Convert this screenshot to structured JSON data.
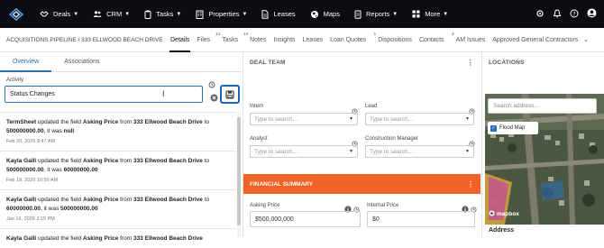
{
  "nav": {
    "items": [
      {
        "label": "Deals",
        "icon": "handshake-icon",
        "caret": true
      },
      {
        "label": "CRM",
        "icon": "people-icon",
        "caret": true
      },
      {
        "label": "Tasks",
        "icon": "clipboard-icon",
        "caret": true
      },
      {
        "label": "Properties",
        "icon": "building-icon",
        "caret": true
      },
      {
        "label": "Leases",
        "icon": "document-icon",
        "caret": false
      },
      {
        "label": "Maps",
        "icon": "globe-icon",
        "caret": false
      },
      {
        "label": "Reports",
        "icon": "report-icon",
        "caret": true
      },
      {
        "label": "More",
        "icon": "grid-icon",
        "caret": true
      }
    ],
    "caret_glyph": "▼"
  },
  "breadcrumb": "ACQUISITIONS PIPELINE / 333 ELLWOOD BEACH DRIVE",
  "tabs": [
    {
      "label": "Details",
      "count": ""
    },
    {
      "label": "Files",
      "count": "14"
    },
    {
      "label": "Tasks",
      "count": "14"
    },
    {
      "label": "Notes",
      "count": ""
    },
    {
      "label": "Insights",
      "count": ""
    },
    {
      "label": "Leases",
      "count": ""
    },
    {
      "label": "Loan Quotes",
      "count": "1"
    },
    {
      "label": "Dispositions",
      "count": ""
    },
    {
      "label": "Contacts",
      "count": "3"
    },
    {
      "label": "AM Issues",
      "count": ""
    },
    {
      "label": "Approved General Contractors",
      "count": ""
    }
  ],
  "left": {
    "subtabs": [
      "Overview",
      "Associations"
    ],
    "activity_label": "Activity",
    "activity_value": "Status Changes",
    "entries": [
      {
        "actor": "TermSheet",
        "t1": " updated the field ",
        "field": "Asking Price",
        "t2": " from ",
        "from": "333 Ellwood Beach Drive",
        "t3": " to ",
        "to": "500000000.00",
        "t4": ", it was ",
        "was": "null",
        "ts": "Feb 20, 2026 8:47 AM"
      },
      {
        "actor": "Kayla Galli",
        "t1": " updated the field ",
        "field": "Asking Price",
        "t2": " from ",
        "from": "333 Ellwood Beach Drive",
        "t3": " to ",
        "to": "500000000.00",
        "t4": ", it was ",
        "was": "60000000.00",
        "ts": "Feb 19, 2026 10:59 AM"
      },
      {
        "actor": "Kayla Galli",
        "t1": " updated the field ",
        "field": "Asking Price",
        "t2": " from ",
        "from": "333 Ellwood Beach Drive",
        "t3": " to ",
        "to": "60000000.00",
        "t4": ", it was ",
        "was": "500000000.00",
        "ts": "Jan 16, 2026 2:15 PM"
      },
      {
        "actor": "Kayla Galli",
        "t1": " updated the field ",
        "field": "Asking Price",
        "t2": " from ",
        "from": "333 Ellwood Beach Drive",
        "t3": "",
        "to": "",
        "t4": "",
        "was": "",
        "ts": ""
      }
    ]
  },
  "deal_team": {
    "title": "DEAL TEAM",
    "fields": [
      {
        "label": "Intern",
        "placeholder": "Type to search..."
      },
      {
        "label": "Lead",
        "placeholder": "Type to search..."
      },
      {
        "label": "Analyst",
        "placeholder": "Type to search..."
      },
      {
        "label": "Construction Manager",
        "placeholder": "Type to search..."
      }
    ]
  },
  "financial": {
    "title": "FINANCIAL SUMMARY",
    "asking_label": "Asking Price",
    "asking_value": "$500,000,000",
    "internal_label": "Internal Price",
    "internal_value": "$0"
  },
  "locations": {
    "title": "LOCATIONS",
    "search_placeholder": "Search address...",
    "flood_label": "Flood Map",
    "mapbox_label": "mapbox",
    "address_label": "Address"
  },
  "colors": {
    "accent": "#1d63b3",
    "financial_header": "#f06223",
    "nav_bg": "#0c0c12"
  }
}
